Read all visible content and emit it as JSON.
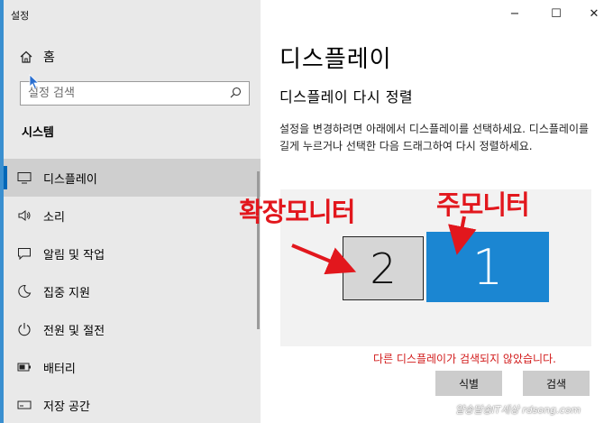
{
  "app": {
    "title": "설정"
  },
  "window_controls": {
    "minimize": "−",
    "maximize": "☐",
    "close": "✕"
  },
  "sidebar": {
    "home_label": "홈",
    "search_placeholder": "설정 검색",
    "section_title": "시스템",
    "items": [
      {
        "label": "디스플레이",
        "icon": "monitor-icon",
        "active": true
      },
      {
        "label": "소리",
        "icon": "speaker-icon"
      },
      {
        "label": "알림 및 작업",
        "icon": "notification-icon"
      },
      {
        "label": "집중 지원",
        "icon": "moon-icon"
      },
      {
        "label": "전원 및 절전",
        "icon": "power-icon"
      },
      {
        "label": "배터리",
        "icon": "battery-icon"
      },
      {
        "label": "저장 공간",
        "icon": "storage-icon"
      }
    ]
  },
  "main": {
    "page_title": "디스플레이",
    "subheading": "디스플레이 다시 정렬",
    "description": "설정을 변경하려면 아래에서 디스플레이를 선택하세요. 디스플레이를 길게 누르거나 선택한 다음 드래그하여 다시 정렬하세요.",
    "monitors": [
      {
        "number": "2",
        "selected": false
      },
      {
        "number": "1",
        "selected": true
      }
    ],
    "annotations": {
      "extended": "확장모니터",
      "primary": "주모니터"
    },
    "error_text": "다른 디스플레이가 검색되지 않았습니다.",
    "identify_label": "식별",
    "detect_label": "검색"
  },
  "watermark": "얄송달송IT세상 rdsong.com",
  "colors": {
    "accent": "#0067b8",
    "monitor_selected": "#1b86d2",
    "annotation": "#e2171d",
    "error": "#d21c1c"
  }
}
